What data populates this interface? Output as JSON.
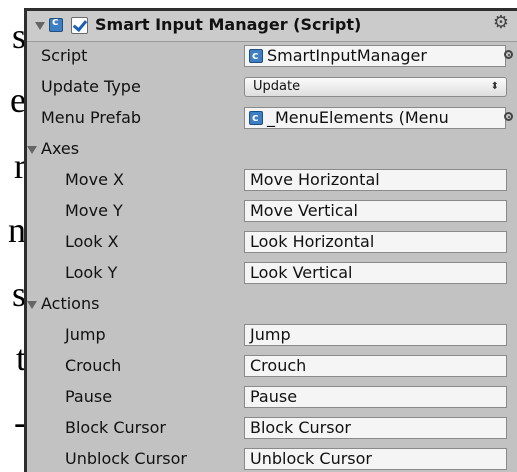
{
  "background_text": {
    "letters": [
      "s",
      "e",
      "r",
      "n",
      "s",
      "t",
      "-"
    ]
  },
  "component": {
    "title": "Smart Input Manager (Script)",
    "enabled": true,
    "gear_icon": "gear-icon"
  },
  "properties": {
    "script_label": "Script",
    "script_value": "SmartInputManager",
    "update_type_label": "Update Type",
    "update_type_value": "Update",
    "menu_prefab_label": "Menu Prefab",
    "menu_prefab_value": "_MenuElements (Menu"
  },
  "axes": {
    "label": "Axes",
    "items": [
      {
        "label": "Move X",
        "value": "Move Horizontal"
      },
      {
        "label": "Move Y",
        "value": "Move Vertical"
      },
      {
        "label": "Look X",
        "value": "Look Horizontal"
      },
      {
        "label": "Look Y",
        "value": "Look Vertical"
      }
    ]
  },
  "actions": {
    "label": "Actions",
    "items": [
      {
        "label": "Jump",
        "value": "Jump"
      },
      {
        "label": "Crouch",
        "value": "Crouch"
      },
      {
        "label": "Pause",
        "value": "Pause"
      },
      {
        "label": "Block Cursor",
        "value": "Block Cursor"
      },
      {
        "label": "Unblock Cursor",
        "value": "Unblock Cursor"
      }
    ]
  },
  "colors": {
    "panel_bg": "#c2c2c2",
    "field_bg": "#f5f5f5",
    "script_icon": "#3d7fc2",
    "checkbox_check": "#1a5fb4"
  }
}
